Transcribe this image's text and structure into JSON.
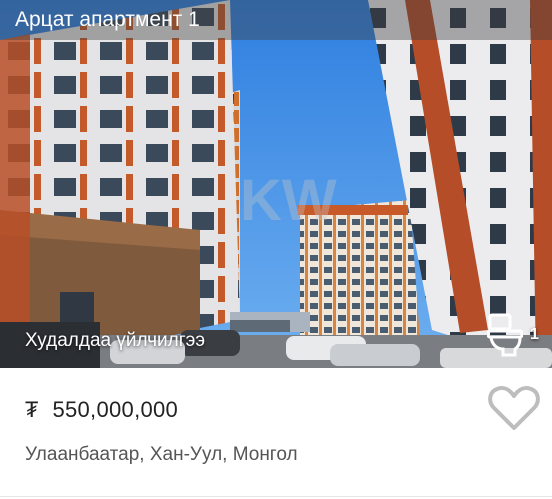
{
  "listing": {
    "title": "Арцат апартмент 1",
    "service_label": "Худалдаа үйлчилгээ",
    "toilet_count": "1",
    "currency_symbol": "₮",
    "price": "550,000,000",
    "location": "Улаанбаатар, Хан-Уул, Монгол"
  },
  "icons": {
    "toilet": "toilet-icon",
    "favorite": "heart-outline-icon",
    "currency": "tugrik-icon"
  },
  "colors": {
    "sky": "#3f8fe6",
    "facade_orange": "#c8612e",
    "facade_white": "#e9e9ea",
    "text_dark": "#222222",
    "text_muted": "#555555",
    "heart_outline": "#bdbdbd"
  }
}
